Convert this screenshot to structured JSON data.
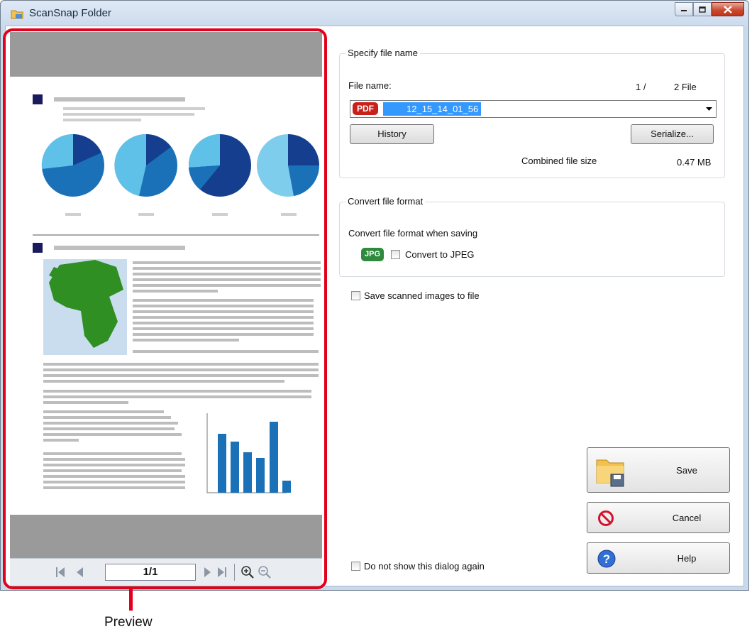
{
  "window": {
    "title": "ScanSnap Folder"
  },
  "preview": {
    "page_indicator": "1/1"
  },
  "callout": {
    "label": "Preview"
  },
  "specify_file_name": {
    "group_label": "Specify file name",
    "file_name_label": "File name:",
    "file_index": "1 /",
    "file_count": "2 File",
    "file_name_value": "12_15_14_01_56",
    "file_type_badge": "PDF",
    "history_button": "History",
    "serialize_button": "Serialize...",
    "combined_size_label": "Combined file size",
    "combined_size_value": "0.47 MB"
  },
  "convert_file_format": {
    "group_label": "Convert file format",
    "convert_when_saving_label": "Convert file format when saving",
    "jpg_badge": "JPG",
    "convert_to_jpeg_label": "Convert to JPEG"
  },
  "save_to_file_label": "Save scanned images to file",
  "dont_show_label": "Do not show this dialog again",
  "buttons": {
    "save": "Save",
    "cancel": "Cancel",
    "help": "Help"
  },
  "colors": {
    "accent_red": "#e3001b",
    "pdf_badge": "#c9201a",
    "jpg_badge": "#2f8a3e",
    "selection": "#3399ff"
  }
}
